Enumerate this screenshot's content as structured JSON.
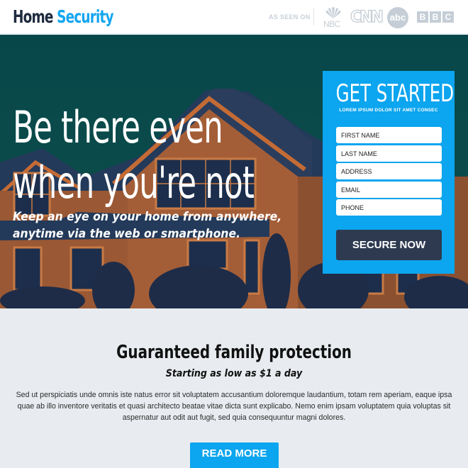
{
  "header": {
    "logo": {
      "word1": "Home",
      "word2": "Security"
    },
    "as_seen_on": "AS SEEN ON",
    "brands": [
      {
        "name": "NBC",
        "icon": "nbc-peacock-logo"
      },
      {
        "name": "CNN",
        "icon": "cnn-logo"
      },
      {
        "name": "abc",
        "icon": "abc-logo"
      },
      {
        "name": "BBC",
        "letters": [
          "B",
          "B",
          "C"
        ],
        "icon": "bbc-logo"
      }
    ]
  },
  "hero": {
    "headline_line1": "Be there even",
    "headline_line2": "when you're not",
    "subline_line1": "Keep an eye on your home from anywhere,",
    "subline_line2": "anytime via the web or smartphone."
  },
  "form": {
    "title": "GET STARTED",
    "subtitle": "LOREM IPSUM DOLOR SIT AMET CONSEC",
    "fields": [
      {
        "placeholder": "FIRST NAME",
        "value": ""
      },
      {
        "placeholder": "LAST NAME",
        "value": ""
      },
      {
        "placeholder": "ADDRESS",
        "value": ""
      },
      {
        "placeholder": "EMAIL",
        "value": ""
      },
      {
        "placeholder": "PHONE",
        "value": ""
      }
    ],
    "submit_label": "SECURE NOW"
  },
  "section": {
    "title": "Guaranteed family protection",
    "subtitle": "Starting as low as $1 a day",
    "body": "Sed ut perspiciatis unde omnis iste natus error sit voluptatem accusantium doloremque laudantium, totam rem aperiam, eaque ipsa quae ab illo inventore veritatis et quasi architecto beatae vitae dicta sunt explicabo. Nemo enim ipsam voluptatem quia voluptas sit aspernatur aut odit aut fugit, sed quia consequuntur magni dolores.",
    "button_label": "READ MORE"
  },
  "colors": {
    "accent": "#0ca5ef",
    "dark": "#2e3a4f",
    "logo_dark": "#1e2a3e",
    "hero_sky": "#08484a",
    "hero_house": "#b0663a",
    "section_bg": "#e8ecf0"
  }
}
